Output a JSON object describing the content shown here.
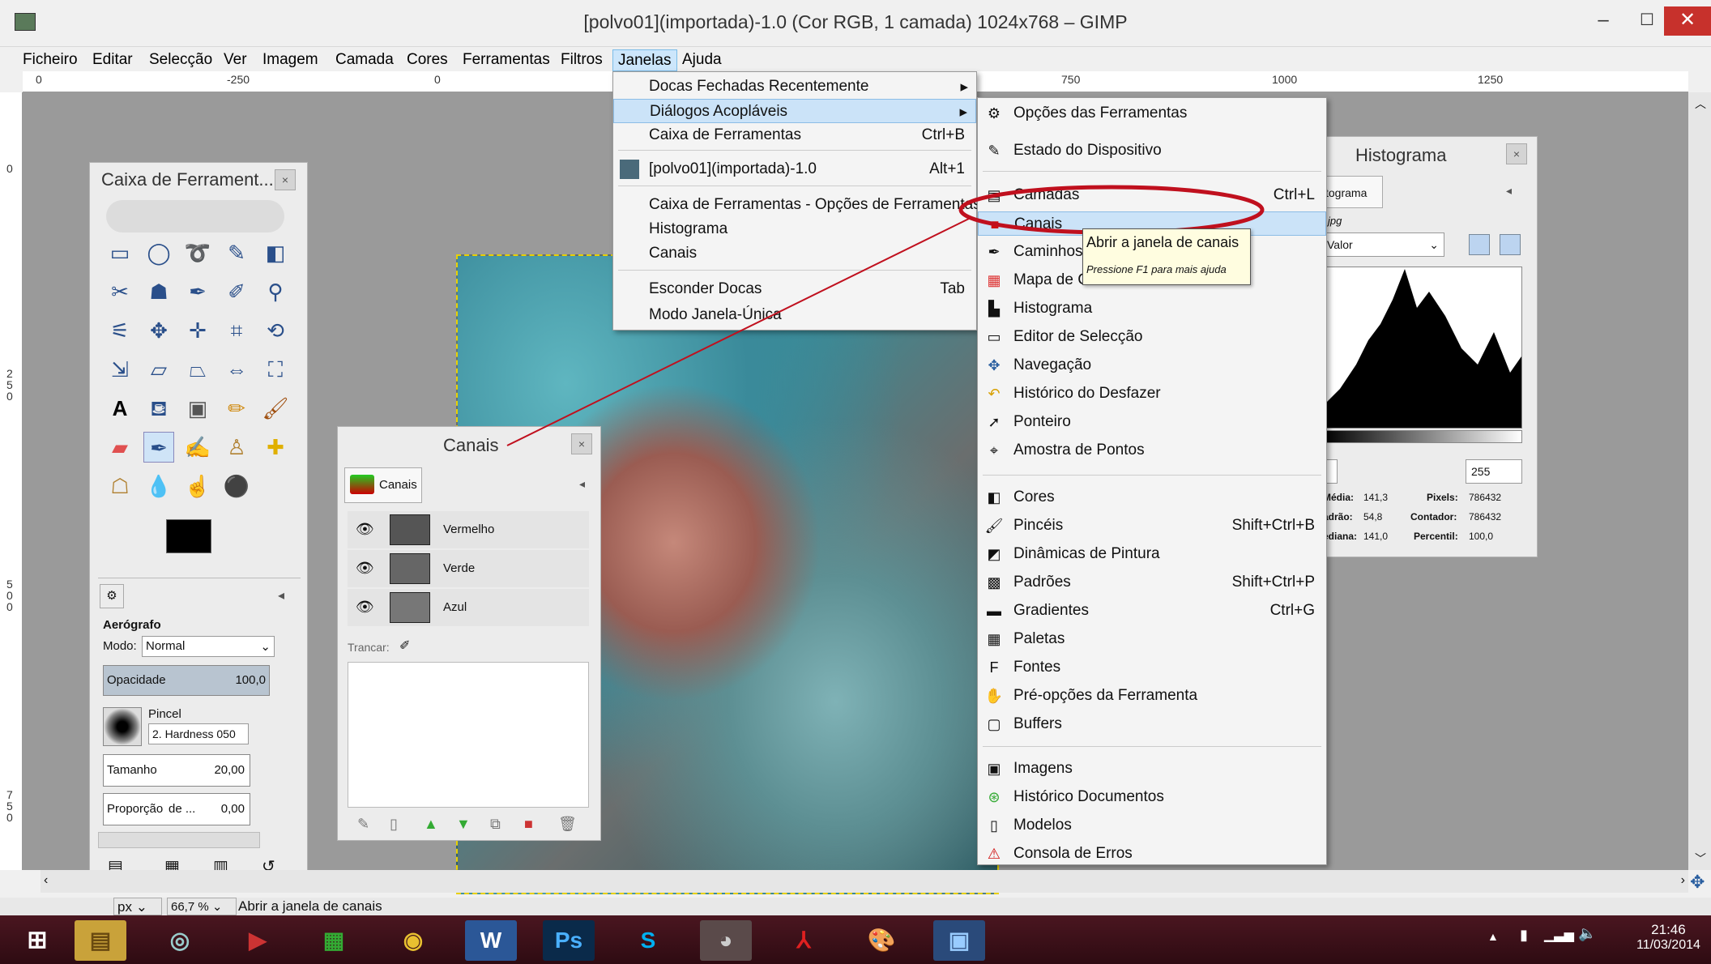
{
  "window": {
    "title": "[polvo01](importada)-1.0 (Cor RGB, 1 camada) 1024x768 – GIMP",
    "minimize": "–",
    "maximize": "☐",
    "close": "✕"
  },
  "menubar": [
    "Ficheiro",
    "Editar",
    "Selecção",
    "Ver",
    "Imagem",
    "Camada",
    "Cores",
    "Ferramentas",
    "Filtros",
    "Janelas",
    "Ajuda"
  ],
  "ruler": {
    "top": [
      "0",
      "-250",
      "0",
      "750",
      "1000",
      "1250"
    ],
    "left": [
      "0",
      "250",
      "500",
      "750"
    ]
  },
  "toolbox": {
    "title": "Caixa de Ferrament...",
    "close": "×",
    "options_title": "Aerógrafo",
    "mode_label": "Modo:",
    "mode_value": "Normal",
    "opacity_label": "Opacidade",
    "opacity_value": "100,0",
    "brush_label": "Pincel",
    "brush_value": "2. Hardness 050",
    "size_label": "Tamanho",
    "size_value": "20,00",
    "ratio_label": "Proporção",
    "ratio_partial": "de ...",
    "ratio_value": "0,00"
  },
  "channels_panel": {
    "title": "Canais",
    "tab": "Canais",
    "close": "×",
    "channels": [
      "Vermelho",
      "Verde",
      "Azul"
    ],
    "lock_label": "Trancar:"
  },
  "histogram_panel": {
    "title": "Histograma",
    "close": "×",
    "tab": "tograma",
    "file": "jpg",
    "channel": "Valor",
    "range_max": "255",
    "stats": {
      "media_label": "Média:",
      "media": "141,3",
      "pixels_label": "Pixels:",
      "pixels": "786432",
      "padrao_label": "adrão:",
      "padrao": "54,8",
      "contador_label": "Contador:",
      "contador": "786432",
      "mediana_label": "ediana:",
      "mediana": "141,0",
      "percentil_label": "Percentil:",
      "percentil": "100,0"
    }
  },
  "janelas_menu": [
    {
      "label": "Docas Fechadas Recentemente",
      "shortcut": "",
      "arrow": "▸"
    },
    {
      "label": "Diálogos Acopláveis",
      "shortcut": "",
      "arrow": "▸"
    },
    {
      "label": "Caixa de Ferramentas",
      "shortcut": "Ctrl+B",
      "arrow": ""
    },
    {
      "label": "[polvo01](importada)-1.0",
      "shortcut": "Alt+1",
      "arrow": ""
    },
    {
      "label": "Caixa de Ferramentas - Opções de Ferramentas",
      "shortcut": "",
      "arrow": ""
    },
    {
      "label": "Histograma",
      "shortcut": "",
      "arrow": ""
    },
    {
      "label": "Canais",
      "shortcut": "",
      "arrow": ""
    },
    {
      "label": "Esconder Docas",
      "shortcut": "Tab",
      "arrow": ""
    },
    {
      "label": "Modo Janela-Única",
      "shortcut": "",
      "arrow": ""
    }
  ],
  "dialogs_menu": [
    {
      "label": "Opções das Ferramentas",
      "shortcut": "",
      "icon": "tool-options-icon"
    },
    {
      "label": "Estado do Dispositivo",
      "shortcut": "",
      "icon": "device-status-icon"
    },
    {
      "label": "Camadas",
      "shortcut": "Ctrl+L",
      "icon": "layers-icon"
    },
    {
      "label": "Canais",
      "shortcut": "",
      "icon": "channels-icon"
    },
    {
      "label": "Caminhos",
      "shortcut": "",
      "icon": "paths-icon"
    },
    {
      "label": "Mapa de C",
      "shortcut": "",
      "icon": "colormap-icon"
    },
    {
      "label": "Histograma",
      "shortcut": "",
      "icon": "histogram-icon"
    },
    {
      "label": "Editor de Selecção",
      "shortcut": "",
      "icon": "selection-editor-icon"
    },
    {
      "label": "Navegação",
      "shortcut": "",
      "icon": "navigation-icon"
    },
    {
      "label": "Histórico do Desfazer",
      "shortcut": "",
      "icon": "undo-history-icon"
    },
    {
      "label": "Ponteiro",
      "shortcut": "",
      "icon": "pointer-icon"
    },
    {
      "label": "Amostra de Pontos",
      "shortcut": "",
      "icon": "sample-points-icon"
    },
    {
      "label": "Cores",
      "shortcut": "",
      "icon": "colors-icon"
    },
    {
      "label": "Pincéis",
      "shortcut": "Shift+Ctrl+B",
      "icon": "brushes-icon"
    },
    {
      "label": "Dinâmicas de Pintura",
      "shortcut": "",
      "icon": "paint-dynamics-icon"
    },
    {
      "label": "Padrões",
      "shortcut": "Shift+Ctrl+P",
      "icon": "patterns-icon"
    },
    {
      "label": "Gradientes",
      "shortcut": "Ctrl+G",
      "icon": "gradients-icon"
    },
    {
      "label": "Paletas",
      "shortcut": "",
      "icon": "palettes-icon"
    },
    {
      "label": "Fontes",
      "shortcut": "",
      "icon": "fonts-icon"
    },
    {
      "label": "Pré-opções da Ferramenta",
      "shortcut": "",
      "icon": "tool-presets-icon"
    },
    {
      "label": "Buffers",
      "shortcut": "",
      "icon": "buffers-icon"
    },
    {
      "label": "Imagens",
      "shortcut": "",
      "icon": "images-icon"
    },
    {
      "label": "Histórico Documentos",
      "shortcut": "",
      "icon": "document-history-icon"
    },
    {
      "label": "Modelos",
      "shortcut": "",
      "icon": "templates-icon"
    },
    {
      "label": "Consola de Erros",
      "shortcut": "",
      "icon": "error-console-icon"
    }
  ],
  "tooltip": {
    "title": "Abrir a janela de canais",
    "hint": "Pressione F1 para mais ajuda"
  },
  "statusbar": {
    "unit": "px",
    "zoom": "66,7 %",
    "message": "Abrir a janela de canais"
  },
  "taskbar": {
    "time": "21:46",
    "date": "11/03/2014",
    "apps": [
      "explorer",
      "remote",
      "media",
      "project",
      "chrome",
      "word",
      "photoshop",
      "skype",
      "gimp",
      "acrobat",
      "paint",
      "photos"
    ]
  },
  "colors": {
    "highlight_ellipse": "#c0101e",
    "accent_blue": "#cbe3f8"
  }
}
